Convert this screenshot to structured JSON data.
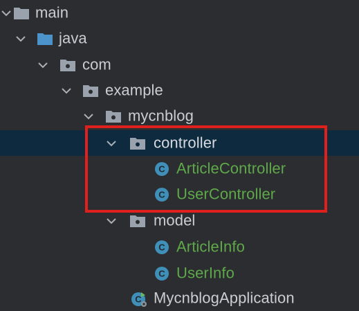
{
  "tree": {
    "nodes": [
      {
        "label": "main",
        "kind": "folder",
        "expanded": true
      },
      {
        "label": "java",
        "kind": "source-folder",
        "expanded": true
      },
      {
        "label": "com",
        "kind": "package",
        "expanded": true
      },
      {
        "label": "example",
        "kind": "package",
        "expanded": true
      },
      {
        "label": "mycnblog",
        "kind": "package",
        "expanded": true
      },
      {
        "label": "controller",
        "kind": "package",
        "expanded": true,
        "selected": true
      },
      {
        "label": "ArticleController",
        "kind": "class"
      },
      {
        "label": "UserController",
        "kind": "class"
      },
      {
        "label": "model",
        "kind": "package",
        "expanded": true
      },
      {
        "label": "ArticleInfo",
        "kind": "class"
      },
      {
        "label": "UserInfo",
        "kind": "class"
      },
      {
        "label": "MycnblogApplication",
        "kind": "spring-boot-class"
      }
    ]
  },
  "colors": {
    "background": "#2b2d30",
    "selection": "#0e2a3f",
    "text": "#c9cdd4",
    "class_text": "#5fa84a",
    "class_icon": "#3f8fb8",
    "folder_icon": "#9aa3ad",
    "source_folder_icon": "#4b93c9",
    "annotation_box": "#e0201c"
  }
}
